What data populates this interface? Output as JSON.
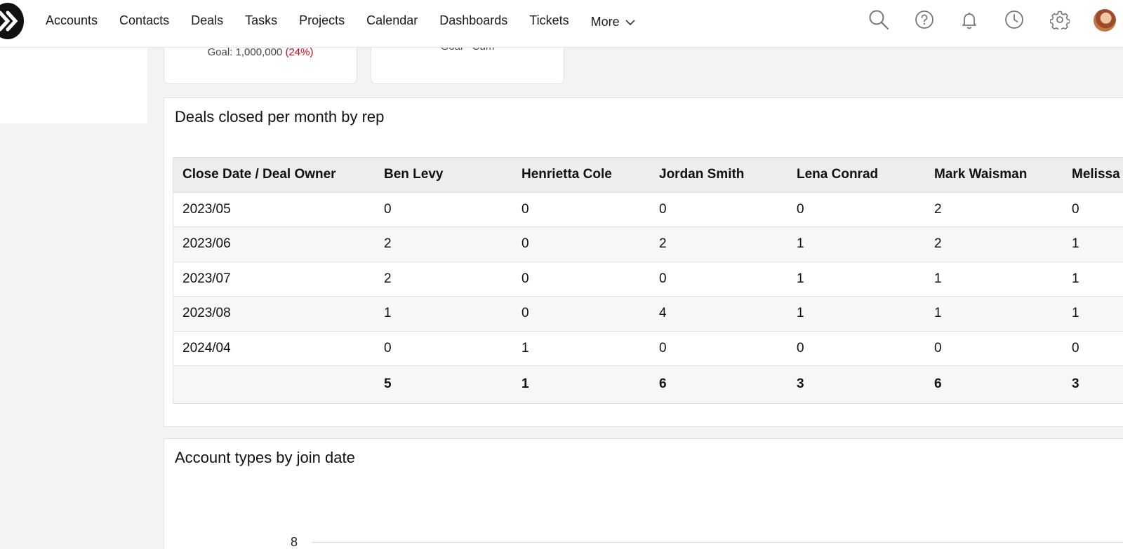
{
  "nav": {
    "items": [
      "Accounts",
      "Contacts",
      "Deals",
      "Tasks",
      "Projects",
      "Calendar",
      "Dashboards",
      "Tickets"
    ],
    "more_label": "More"
  },
  "kpi": {
    "goal_label": "Goal: 1,000,000",
    "goal_percent": "(24%)",
    "second_goal_label": "Goal - Cum"
  },
  "deals_table": {
    "title": "Deals closed per month by rep",
    "columns": [
      "Close Date / Deal Owner",
      "Ben Levy",
      "Henrietta Cole",
      "Jordan Smith",
      "Lena Conrad",
      "Mark Waisman",
      "Melissa"
    ],
    "rows": [
      [
        "2023/05",
        "0",
        "0",
        "0",
        "0",
        "2",
        "0"
      ],
      [
        "2023/06",
        "2",
        "0",
        "2",
        "1",
        "2",
        "1"
      ],
      [
        "2023/07",
        "2",
        "0",
        "0",
        "1",
        "1",
        "1"
      ],
      [
        "2023/08",
        "1",
        "0",
        "4",
        "1",
        "1",
        "1"
      ],
      [
        "2024/04",
        "0",
        "1",
        "0",
        "0",
        "0",
        "0"
      ]
    ],
    "totals": [
      "",
      "5",
      "1",
      "6",
      "3",
      "6",
      "3"
    ]
  },
  "account_chart": {
    "title": "Account types by join date",
    "y_tick": "8"
  },
  "colors": {
    "accent_red": "#d0021b",
    "header_bg": "#ededed"
  },
  "icons": [
    "search-icon",
    "help-icon",
    "bell-icon",
    "history-icon",
    "gear-icon"
  ]
}
